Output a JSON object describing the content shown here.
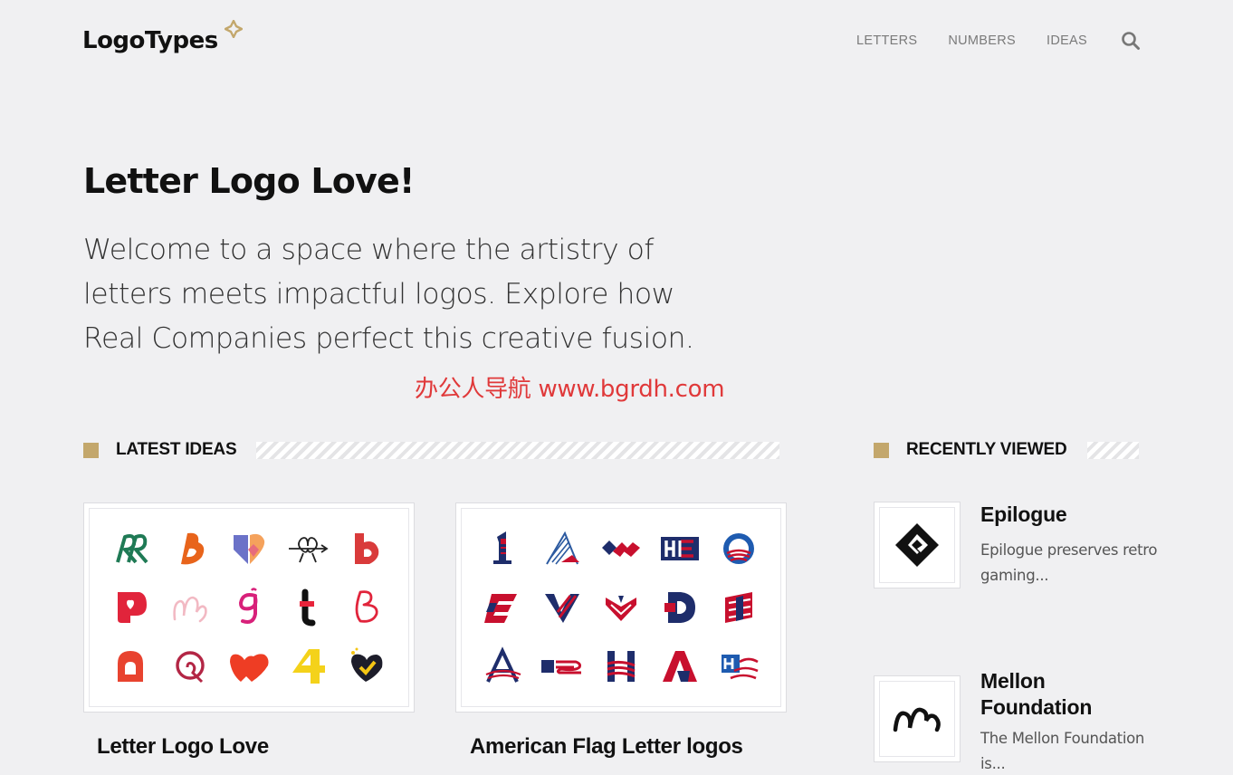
{
  "header": {
    "logo": "LogoTypes",
    "nav": [
      "LETTERS",
      "NUMBERS",
      "IDEAS"
    ]
  },
  "hero": {
    "title": "Letter Logo Love!",
    "text": "Welcome to a space where the artistry of letters meets impactful logos. Explore how Real Companies perfect this creative fusion."
  },
  "watermark": "办公人导航 www.bgrdh.com",
  "latest": {
    "heading": "LATEST IDEAS",
    "cards": [
      {
        "title": "Letter Logo Love"
      },
      {
        "title": "American Flag Letter logos"
      }
    ]
  },
  "recent": {
    "heading": "RECENTLY VIEWED",
    "items": [
      {
        "title": "Epilogue",
        "desc": "Epilogue preserves retro gaming..."
      },
      {
        "title": "Mellon Foundation",
        "desc": "The Mellon Foundation is..."
      }
    ]
  },
  "colors": {
    "accent": "#c3a76c",
    "background": "#f0f0f2",
    "watermark": "#e0393a"
  }
}
